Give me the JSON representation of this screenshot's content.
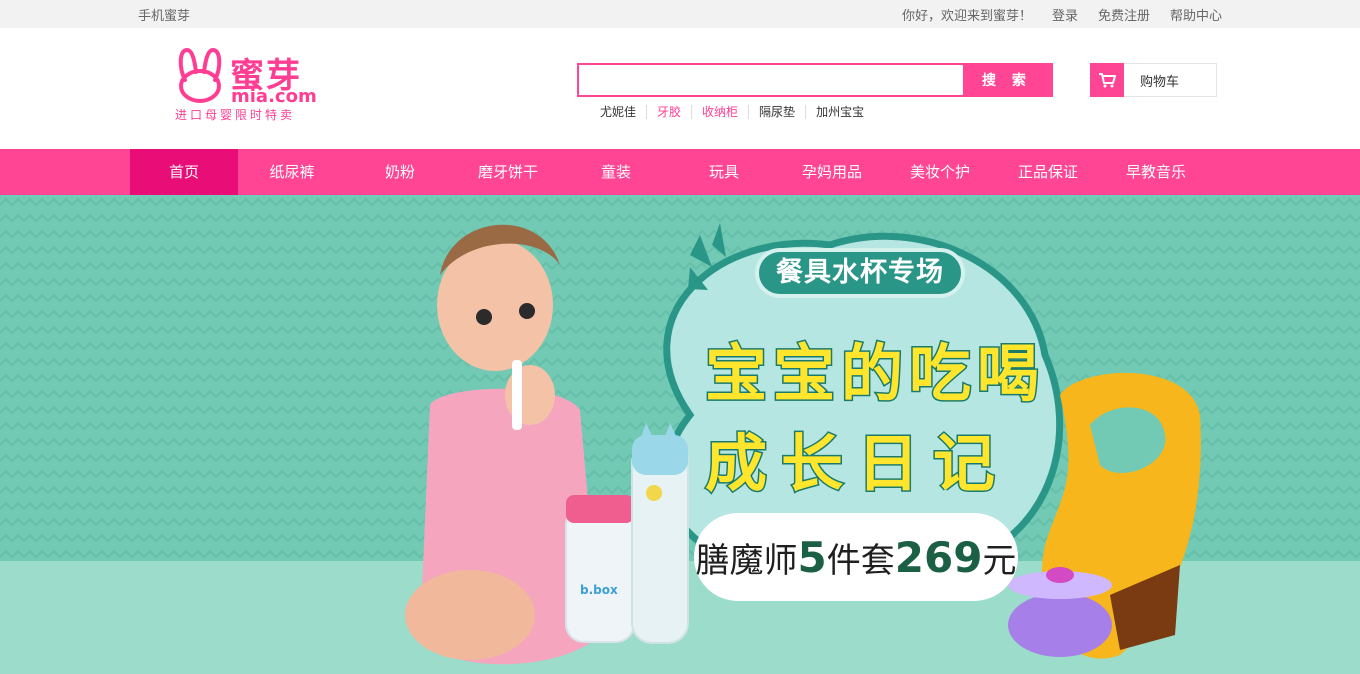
{
  "topbar": {
    "mobile_link": "手机蜜芽",
    "welcome": "你好，欢迎来到蜜芽！",
    "login": "登录",
    "register": "免费注册",
    "help": "帮助中心"
  },
  "logo": {
    "name": "蜜芽",
    "domain": "mia.com",
    "slogan": "进口母婴限时特卖"
  },
  "search": {
    "value": "",
    "placeholder": "",
    "button_label": "搜 索",
    "hot_words": [
      {
        "text": "尤妮佳",
        "highlight": false
      },
      {
        "text": "牙胶",
        "highlight": true
      },
      {
        "text": "收纳柜",
        "highlight": true
      },
      {
        "text": "隔尿垫",
        "highlight": false
      },
      {
        "text": "加州宝宝",
        "highlight": false
      }
    ]
  },
  "cart": {
    "label": "购物车",
    "icon": "cart-icon"
  },
  "nav": {
    "items": [
      "首页",
      "纸尿裤",
      "奶粉",
      "磨牙饼干",
      "童装",
      "玩具",
      "孕妈用品",
      "美妆个护",
      "正品保证",
      "早教音乐"
    ],
    "active_index": 0
  },
  "banner": {
    "tag": "餐具水杯专场",
    "line1": "宝宝的吃喝",
    "line2": "成长日记",
    "promo_brand": "膳魔师",
    "promo_count": "5",
    "promo_unit": "件套",
    "promo_price": "269",
    "promo_currency": "元",
    "bottle_brand": "b.box"
  },
  "colors": {
    "brand_pink": "#ff4593",
    "nav_active": "#e90e77",
    "banner_bg": "#72c9b4",
    "headline_yellow": "#ffe62c"
  }
}
